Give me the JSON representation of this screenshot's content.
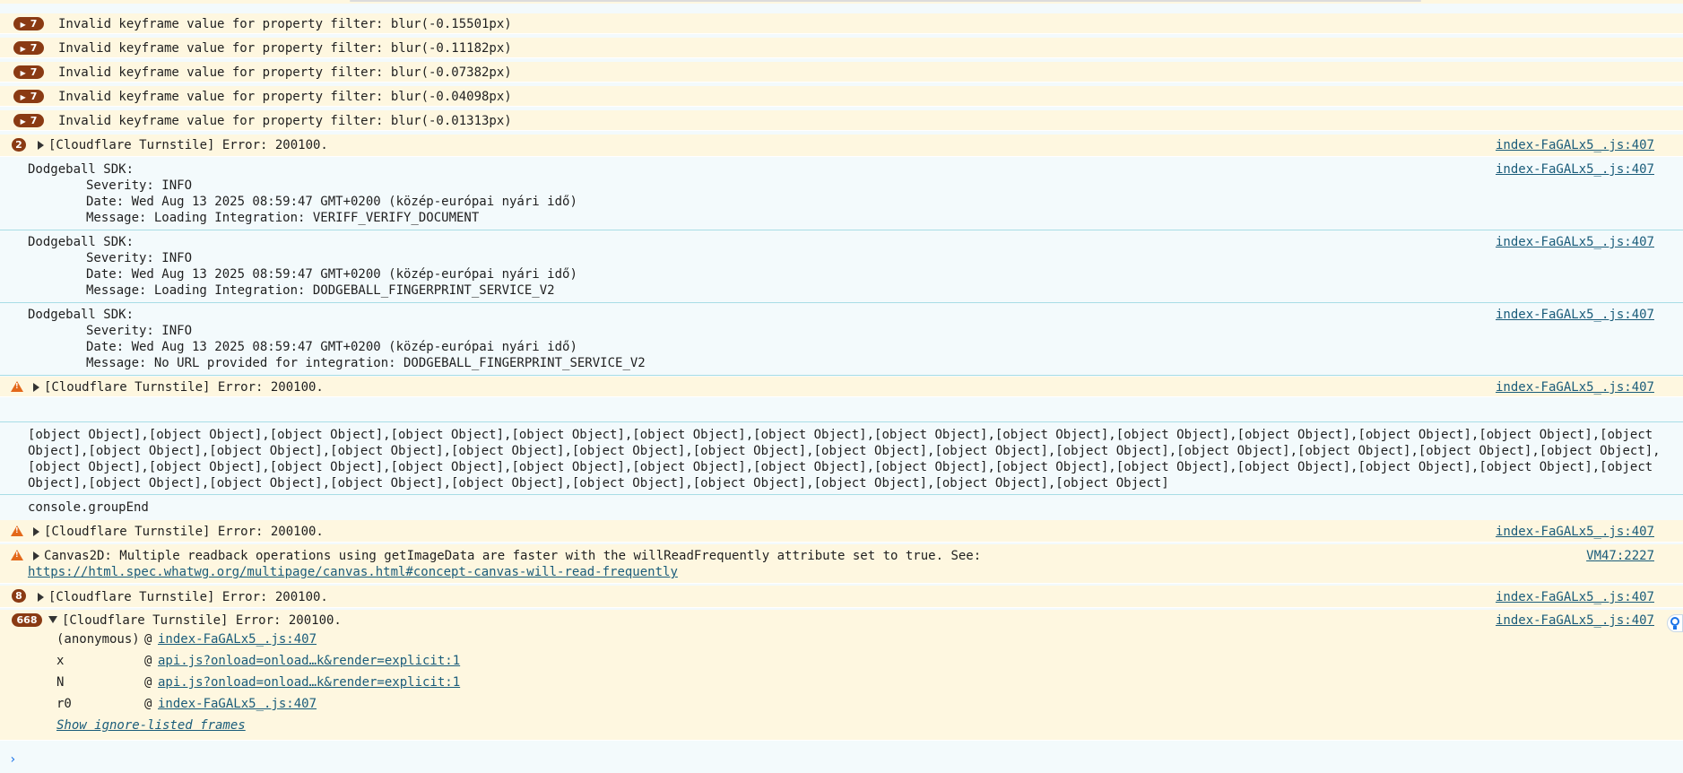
{
  "repeat_badges": [
    {
      "count": "7",
      "text": "Invalid keyframe value for property filter: blur(-0.15501px)"
    },
    {
      "count": "7",
      "text": "Invalid keyframe value for property filter: blur(-0.11182px)"
    },
    {
      "count": "7",
      "text": "Invalid keyframe value for property filter: blur(-0.07382px)"
    },
    {
      "count": "7",
      "text": "Invalid keyframe value for property filter: blur(-0.04098px)"
    },
    {
      "count": "7",
      "text": "Invalid keyframe value for property filter: blur(-0.01313px)"
    }
  ],
  "turnstile_2": {
    "count": "2",
    "text": "[Cloudflare Turnstile] Error: 200100.",
    "source": "index-FaGALx5_.js:407"
  },
  "sdk_logs": [
    {
      "header": "Dodgeball SDK:",
      "severity": "Severity: INFO",
      "date": "Date: Wed Aug 13 2025 08:59:47 GMT+0200 (közép-európai nyári idő)",
      "message": "Message: Loading Integration: VERIFF_VERIFY_DOCUMENT",
      "source": "index-FaGALx5_.js:407"
    },
    {
      "header": "Dodgeball SDK:",
      "severity": "Severity: INFO",
      "date": "Date: Wed Aug 13 2025 08:59:47 GMT+0200 (közép-európai nyári idő)",
      "message": "Message: Loading Integration: DODGEBALL_FINGERPRINT_SERVICE_V2",
      "source": "index-FaGALx5_.js:407"
    },
    {
      "header": "Dodgeball SDK:",
      "severity": "Severity: INFO",
      "date": "Date: Wed Aug 13 2025 08:59:47 GMT+0200 (közép-európai nyári idő)",
      "message": "Message: No URL provided for integration: DODGEBALL_FINGERPRINT_SERVICE_V2",
      "source": "index-FaGALx5_.js:407"
    }
  ],
  "turnstile_warn_1": {
    "text": "[Cloudflare Turnstile] Error: 200100.",
    "source": "index-FaGALx5_.js:407"
  },
  "object_lines": [
    "[object Object],[object Object],[object Object],[object Object],[object Object],[object Object],[object Object],[object Object],[object Object],[object Object],[object Object],[object Object],[object Object],[object",
    "Object],[object Object],[object Object],[object Object],[object Object],[object Object],[object Object],[object Object],[object Object],[object Object],[object Object],[object Object],[object Object],[object Object],",
    "[object Object],[object Object],[object Object],[object Object],[object Object],[object Object],[object Object],[object Object],[object Object],[object Object],[object Object],[object Object],[object Object],[object",
    "Object],[object Object],[object Object],[object Object],[object Object],[object Object],[object Object],[object Object],[object Object],[object Object]"
  ],
  "group_end": "console.groupEnd",
  "turnstile_warn_2": {
    "text": "[Cloudflare Turnstile] Error: 200100.",
    "source": "index-FaGALx5_.js:407"
  },
  "canvas_warn": {
    "text": "Canvas2D: Multiple readback operations using getImageData are faster with the willReadFrequently attribute set to true. See:",
    "link": "https://html.spec.whatwg.org/multipage/canvas.html#concept-canvas-will-read-frequently",
    "source": "VM47:2227"
  },
  "turnstile_8": {
    "count": "8",
    "text": "[Cloudflare Turnstile] Error: 200100.",
    "source": "index-FaGALx5_.js:407"
  },
  "turnstile_668": {
    "count": "668",
    "text": "[Cloudflare Turnstile] Error: 200100.",
    "source": "index-FaGALx5_.js:407",
    "stack": [
      {
        "fn": "(anonymous)",
        "at": "@",
        "link": "index-FaGALx5_.js:407"
      },
      {
        "fn": "x",
        "at": "@",
        "link": "api.js?onload=onload…k&render=explicit:1"
      },
      {
        "fn": "N",
        "at": "@",
        "link": "api.js?onload=onload…k&render=explicit:1"
      },
      {
        "fn": "r0",
        "at": "@",
        "link": "index-FaGALx5_.js:407"
      }
    ],
    "show_frames": "Show ignore-listed frames"
  },
  "prompt_symbol": "›",
  "icons": {
    "warning": "warning-icon",
    "expand": "expand-triangle-icon",
    "collapse": "collapse-triangle-icon",
    "insights": "lightbulb-icon"
  }
}
